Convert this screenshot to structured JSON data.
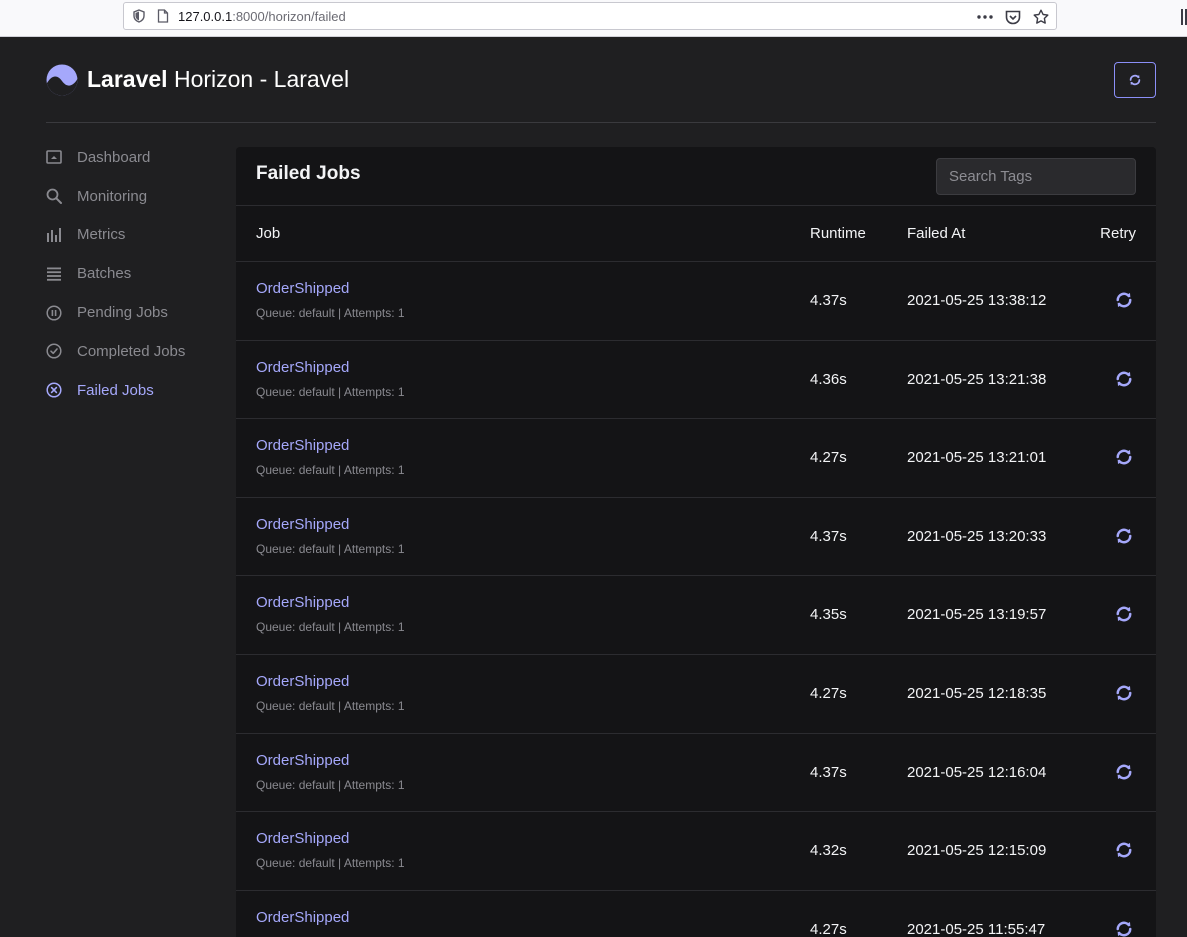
{
  "browser": {
    "url_host": "127.0.0.1",
    "url_rest": ":8000/horizon/failed",
    "icons": [
      "shield-icon",
      "page-icon",
      "more-icon",
      "pocket-icon",
      "bookmark-star-icon"
    ]
  },
  "header": {
    "brand_bold": "Laravel",
    "brand_rest": "Horizon - Laravel",
    "refresh_icon": "refresh-icon"
  },
  "sidebar": {
    "items": [
      {
        "label": "Dashboard",
        "icon": "dashboard-icon"
      },
      {
        "label": "Monitoring",
        "icon": "search-icon"
      },
      {
        "label": "Metrics",
        "icon": "bar-chart-icon"
      },
      {
        "label": "Batches",
        "icon": "list-icon"
      },
      {
        "label": "Pending Jobs",
        "icon": "pause-circle-icon"
      },
      {
        "label": "Completed Jobs",
        "icon": "check-circle-icon"
      },
      {
        "label": "Failed Jobs",
        "icon": "x-circle-icon",
        "active": true
      }
    ]
  },
  "card": {
    "title": "Failed Jobs",
    "search_placeholder": "Search Tags"
  },
  "columns": {
    "job": "Job",
    "runtime": "Runtime",
    "failed_at": "Failed At",
    "retry": "Retry"
  },
  "rows": [
    {
      "name": "OrderShipped",
      "meta": "Queue: default | Attempts: 1",
      "runtime": "4.37s",
      "failed_at": "2021-05-25 13:38:12"
    },
    {
      "name": "OrderShipped",
      "meta": "Queue: default | Attempts: 1",
      "runtime": "4.36s",
      "failed_at": "2021-05-25 13:21:38"
    },
    {
      "name": "OrderShipped",
      "meta": "Queue: default | Attempts: 1",
      "runtime": "4.27s",
      "failed_at": "2021-05-25 13:21:01"
    },
    {
      "name": "OrderShipped",
      "meta": "Queue: default | Attempts: 1",
      "runtime": "4.37s",
      "failed_at": "2021-05-25 13:20:33"
    },
    {
      "name": "OrderShipped",
      "meta": "Queue: default | Attempts: 1",
      "runtime": "4.35s",
      "failed_at": "2021-05-25 13:19:57"
    },
    {
      "name": "OrderShipped",
      "meta": "Queue: default | Attempts: 1",
      "runtime": "4.27s",
      "failed_at": "2021-05-25 12:18:35"
    },
    {
      "name": "OrderShipped",
      "meta": "Queue: default | Attempts: 1",
      "runtime": "4.37s",
      "failed_at": "2021-05-25 12:16:04"
    },
    {
      "name": "OrderShipped",
      "meta": "Queue: default | Attempts: 1",
      "runtime": "4.32s",
      "failed_at": "2021-05-25 12:15:09"
    },
    {
      "name": "OrderShipped",
      "meta": "",
      "runtime": "4.27s",
      "failed_at": "2021-05-25 11:55:47"
    }
  ],
  "colors": {
    "accent": "#a5a8fb",
    "background": "#1f1f21",
    "card": "#141416"
  }
}
